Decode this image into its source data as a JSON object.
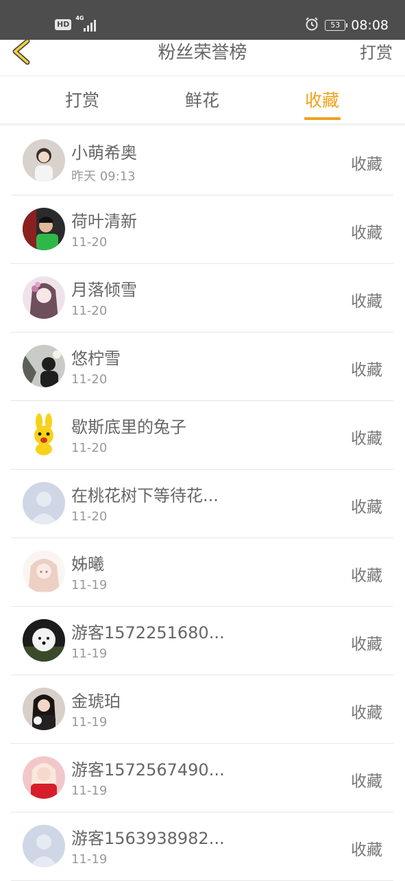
{
  "status_bar": {
    "hd": "HD",
    "network": "4G",
    "battery": "53",
    "time": "08:08",
    "icons": [
      "alarm-icon",
      "signal-icon",
      "battery-icon"
    ]
  },
  "header": {
    "title": "粉丝荣誉榜",
    "action": "打赏",
    "back_icon": "chevron-left-icon"
  },
  "tabs": {
    "items": [
      "打赏",
      "鲜花",
      "收藏"
    ],
    "active": "收藏"
  },
  "colors": {
    "accent": "#f0a21c",
    "text": "#666666",
    "subtext": "#999999",
    "status_bar": "#4d4d4d"
  },
  "list": [
    {
      "name": "小萌希奥",
      "time": "昨天 09:13",
      "action": "收藏",
      "avatar": "girl-photo"
    },
    {
      "name": "荷叶清新",
      "time": "11-20",
      "action": "收藏",
      "avatar": "boy-photo"
    },
    {
      "name": "月落倾雪",
      "time": "11-20",
      "action": "收藏",
      "avatar": "anime-girl"
    },
    {
      "name": "悠柠雪",
      "time": "11-20",
      "action": "收藏",
      "avatar": "silhouette-photo"
    },
    {
      "name": "歇斯底里的兔子",
      "time": "11-20",
      "action": "收藏",
      "avatar": "yellow-rabbit"
    },
    {
      "name": "在桃花树下等待花...",
      "time": "11-20",
      "action": "收藏",
      "avatar": "default-avatar"
    },
    {
      "name": "姊曦",
      "time": "11-19",
      "action": "收藏",
      "avatar": "anime-girl-pink"
    },
    {
      "name": "游客1572251680...",
      "time": "11-19",
      "action": "收藏",
      "avatar": "white-dog"
    },
    {
      "name": "金琥珀",
      "time": "11-19",
      "action": "收藏",
      "avatar": "girl-dark-photo"
    },
    {
      "name": "游客1572567490...",
      "time": "11-19",
      "action": "收藏",
      "avatar": "girl-red-photo"
    },
    {
      "name": "游客1563938982...",
      "time": "11-19",
      "action": "收藏",
      "avatar": "default-avatar"
    }
  ]
}
